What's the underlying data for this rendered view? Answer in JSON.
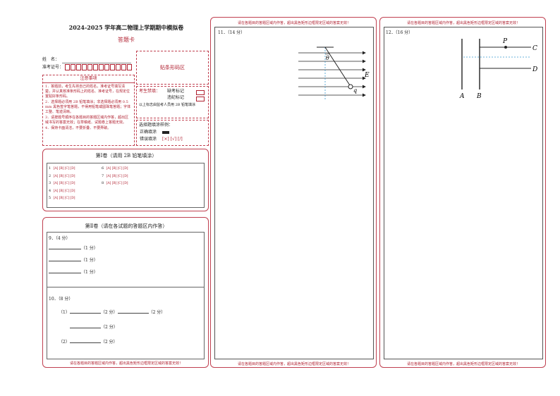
{
  "header": {
    "title": "2024-2025 学年高二物理上学期期中模拟卷",
    "subtitle": "答题卡"
  },
  "student": {
    "name_label": "姓　名：",
    "id_label": "准考证号："
  },
  "barcode_area": "贴条形码区",
  "notice": {
    "title": "注意事项",
    "items": [
      "1．答题前，考生先将自己的姓名，准考证号填写清楚，并认真核准条形码上的姓名、准考证号，在规定位置贴好条形码。",
      "2．选择题必须用 2B 铅笔填涂；非选择题必须用 0.5 mm 黑色签字笔答题，不得用铅笔或圆珠笔答题；字体工整、笔迹清晰。",
      "3．请按题号顺序在各题目的答题区域内作答，超出区域书写的答案无效；在草稿纸、试题卷上答题无效。",
      "4．保持卡面清洁，不要折叠、不要弄破。"
    ]
  },
  "examinee_mark": {
    "label": "考生禁填：",
    "absent": "缺考标记",
    "violation": "违纪标记",
    "note": "以上标志由监考人员用 2B 铅笔填涂"
  },
  "fill_sample": {
    "title": "选择题填涂样例：",
    "correct": "正确填涂",
    "wrong": "错误填涂",
    "wrong_marks": "[×]  [√]  [/]"
  },
  "section1": {
    "title": "第Ⅰ卷（请用 2B 铅笔填涂）",
    "options": [
      "[A]",
      "[B]",
      "[C]",
      "[D]"
    ],
    "col1": [
      "1",
      "2",
      "3",
      "4",
      "5"
    ],
    "col2": [
      "6",
      "7",
      "8"
    ]
  },
  "section2": {
    "title": "第Ⅱ卷（请在各试题的答题区内作答）",
    "q9_label": "9．（4 分）",
    "q9_score": "（1 分）",
    "q10_label": "10．（8 分）",
    "q10_part1": "（1）",
    "q10_part2": "（2）",
    "score2": "（2 分）"
  },
  "warning": "请在各题目的答题区域内作答，超出黑色矩形边框限定区域的答案无效！",
  "q11": {
    "label": "11．（14 分）",
    "theta": "θ",
    "e_label": "E",
    "q_label": "q"
  },
  "q12": {
    "label": "12．（16 分）",
    "p": "P",
    "c": "C",
    "d": "D",
    "a": "A",
    "b": "B"
  }
}
